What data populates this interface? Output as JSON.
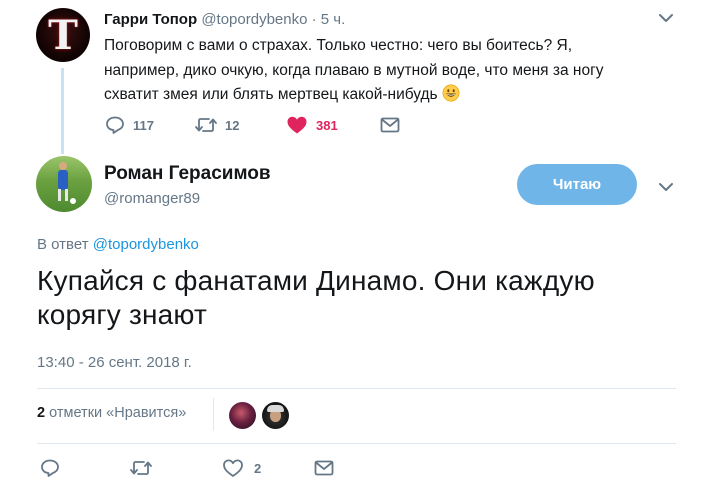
{
  "parent_tweet": {
    "author_name": "Гарри Топор",
    "author_handle": "@topordybenko",
    "separator": "·",
    "time_ago": "5 ч.",
    "avatar_letter": "Т",
    "text_lines": [
      "Поговорим с вами о страхах. Только честно: чего вы боитесь? Я,",
      "например, дико очкую, когда плаваю в мутной воде, что меня за ногу",
      "схватит змея или блять мертвец какой-нибудь"
    ],
    "emoji": "grinning-face-emoji",
    "replies_count": "117",
    "retweets_count": "12",
    "likes_count": "381",
    "liked": true,
    "like_color": "#e0245e"
  },
  "main_tweet": {
    "author_name": "Роман Герасимов",
    "author_handle": "@romanger89",
    "follow_button_label": "Читаю",
    "reply_prefix": "В ответ",
    "reply_mention": "@topordybenko",
    "text_lines": [
      "Купайся с фанатами Динамо. Они каждую",
      "корягу знают"
    ],
    "timestamp": "13:40 - 26 сент. 2018 г.",
    "likes_summary_count": "2",
    "likes_summary_label": "отметки «Нравится»",
    "likes_count": "2"
  },
  "colors": {
    "accent": "#1b95e0",
    "follow_button": "#70b5e8",
    "secondary_text": "#657786",
    "thread_line": "#c4e3f5"
  },
  "icons": {
    "reply": "reply-icon",
    "retweet": "retweet-icon",
    "like": "heart-icon",
    "dm": "envelope-icon",
    "menu": "chevron-down-icon"
  }
}
